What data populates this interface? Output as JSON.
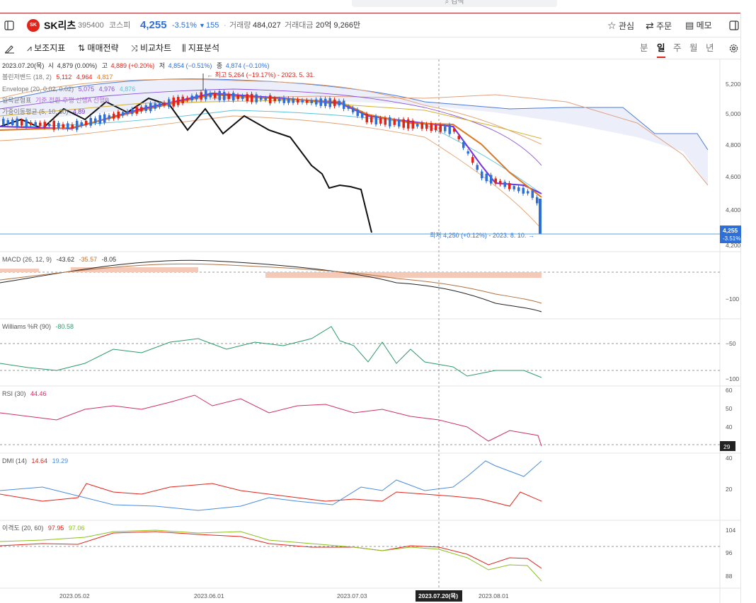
{
  "search": {
    "placeholder": "검색"
  },
  "stock": {
    "name": "SK리츠",
    "code": "395400",
    "market": "코스피",
    "price": "4,255",
    "change_pct": "-3.51%",
    "change_sign": "▼",
    "change_abs": "155",
    "volume_label": "거래량",
    "volume": "484,027",
    "value_label": "거래대금",
    "value": "20억 9,266만"
  },
  "actions": {
    "watch": "관심",
    "order": "주문",
    "memo": "메모"
  },
  "toolbar": {
    "indicators": "보조지표",
    "strategy": "매매전략",
    "compare": "비교차트",
    "analysis": "지표분석",
    "periods": [
      "분",
      "일",
      "주",
      "월",
      "년"
    ],
    "active_period": "일"
  },
  "colors": {
    "up": "#e2231a",
    "down": "#2f6fd8",
    "accent": "#b4232a"
  },
  "legend": {
    "ohlc": {
      "date": "2023.07.20(목)",
      "o_label": "시",
      "o": "4,879 (0.00%)",
      "h_label": "고",
      "h": "4,889 (+0.20%)",
      "l_label": "저",
      "l": "4,854 (−0.51%)",
      "c_label": "종",
      "c": "4,874 (−0.10%)"
    },
    "bollinger": {
      "name": "볼린저밴드 (18, 2)",
      "v1": "5,112",
      "v2": "4,964",
      "v3": "4,817"
    },
    "envelope": {
      "name": "Envelope (20, 0.02, 0.02)",
      "v1": "5,075",
      "v2": "4,976",
      "v3": "4,876"
    },
    "ichimoku": {
      "name": "일목균형표",
      "rest": "기준 전환 후행 선행A 선행B"
    },
    "wma": {
      "name": "가중이동평균 (5, 10, 60)",
      "v": "4,89"
    }
  },
  "annotations": {
    "high": "← 최고 5,264 (−19.17%) - 2023. 5. 31.",
    "low": "최저 4,250 (+0.12%) - 2023. 8. 10. →"
  },
  "price_axis": {
    "ticks": [
      "5,200",
      "5,000",
      "4,800",
      "4,600",
      "4,400",
      "4,200"
    ],
    "current": "4,255",
    "current_pct": "-3.51%"
  },
  "macd": {
    "name": "MACD (26, 12, 9)",
    "v1": "-43.62",
    "v2": "-35.57",
    "v3": "-8.05",
    "tick": "−100"
  },
  "williams": {
    "name": "Williams %R (90)",
    "v": "-80.58",
    "ticks": [
      "−50",
      "−100"
    ]
  },
  "rsi": {
    "name": "RSI (30)",
    "v": "44.46",
    "ticks": [
      "60",
      "50",
      "40"
    ],
    "current": "29"
  },
  "dmi": {
    "name": "DMI (14)",
    "v1": "14.64",
    "v2": "19.29",
    "ticks": [
      "40",
      "20"
    ]
  },
  "disparity": {
    "name": "이격도 (20, 60)",
    "v1": "97.95",
    "v2": "97.06",
    "ticks": [
      "104",
      "96",
      "88"
    ]
  },
  "x_axis": {
    "labels": [
      "2023.05.02",
      "2023.06.01",
      "2023.07.03",
      "2023.08.01"
    ],
    "cursor": "2023.07.20(목)"
  }
}
